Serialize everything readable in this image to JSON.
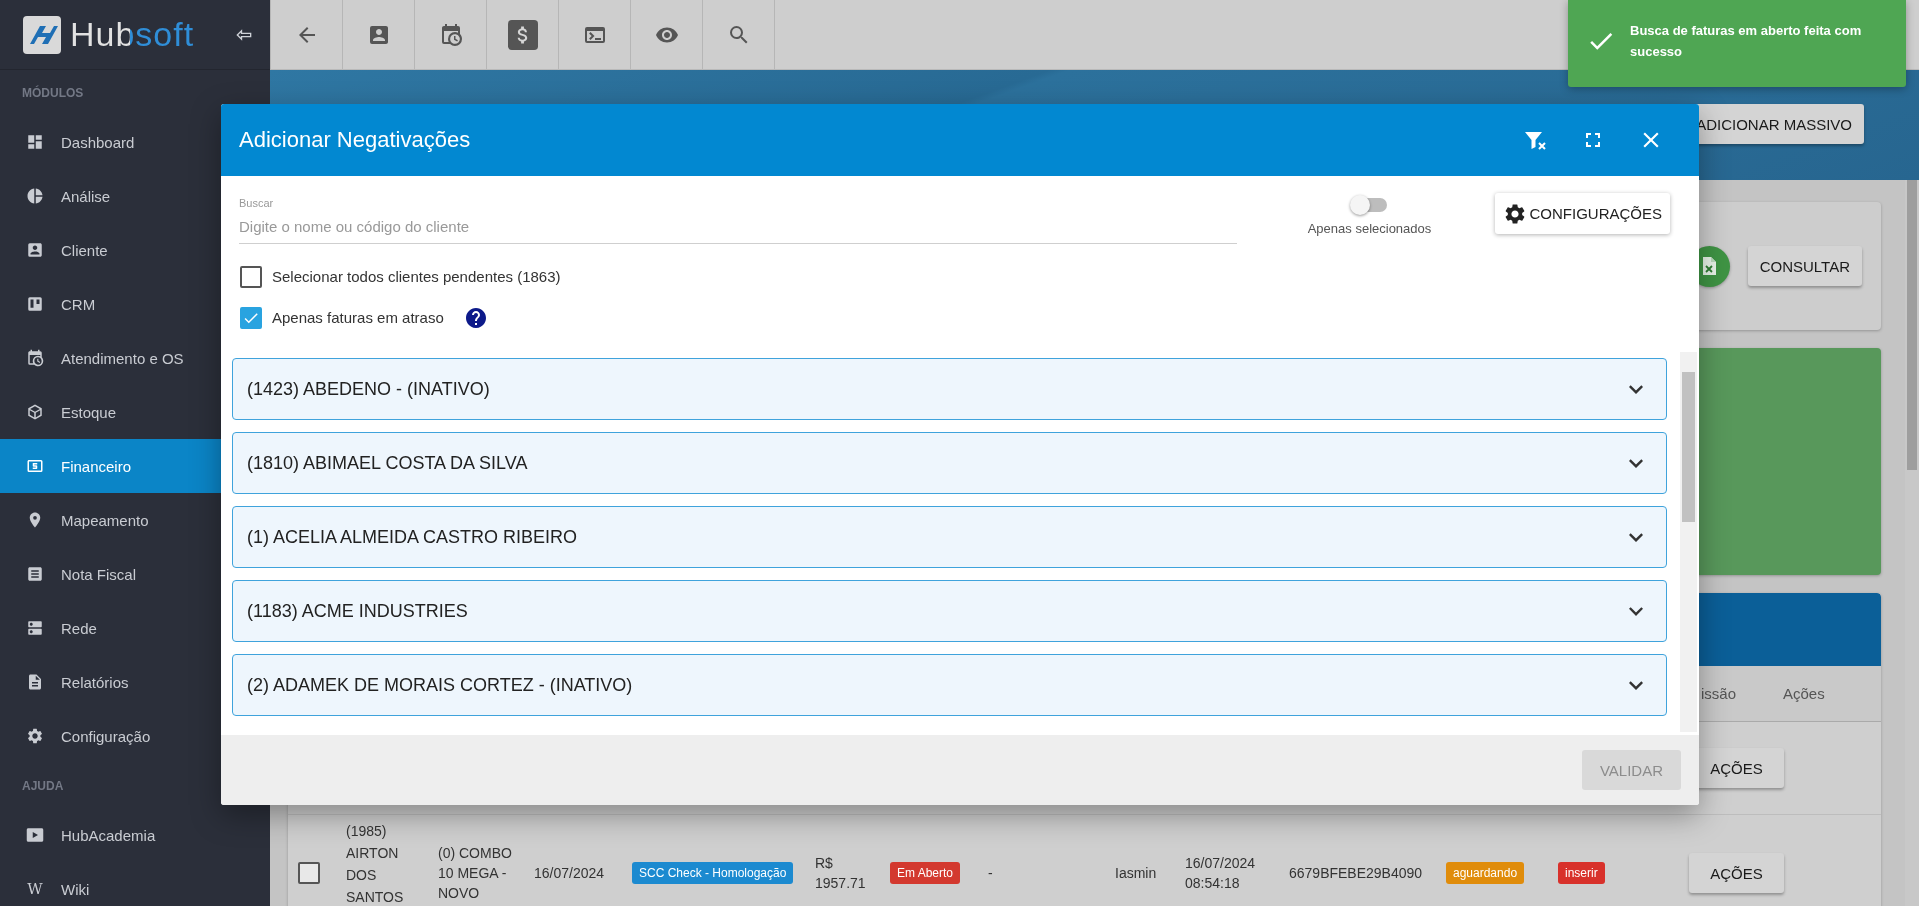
{
  "sidebar": {
    "logo": "Hubsoft",
    "sections": [
      {
        "title": "MÓDULOS",
        "items": [
          {
            "label": "Dashboard",
            "selected": false
          },
          {
            "label": "Análise",
            "selected": false
          },
          {
            "label": "Cliente",
            "selected": false
          },
          {
            "label": "CRM",
            "selected": false
          },
          {
            "label": "Atendimento e OS",
            "selected": false
          },
          {
            "label": "Estoque",
            "selected": false
          },
          {
            "label": "Financeiro",
            "selected": true
          },
          {
            "label": "Mapeamento",
            "selected": false
          },
          {
            "label": "Nota Fiscal",
            "selected": false
          },
          {
            "label": "Rede",
            "selected": false
          },
          {
            "label": "Relatórios",
            "selected": false
          },
          {
            "label": "Configuração",
            "selected": false
          }
        ]
      },
      {
        "title": "AJUDA",
        "items": [
          {
            "label": "HubAcademia",
            "selected": false
          },
          {
            "label": "Wiki",
            "selected": false,
            "icon_char": "W"
          }
        ]
      }
    ]
  },
  "toolbar": {
    "buttons": [
      {
        "selected": false
      },
      {
        "selected": false
      },
      {
        "selected": false
      },
      {
        "selected": true
      },
      {
        "selected": false
      },
      {
        "selected": false
      },
      {
        "selected": false
      }
    ]
  },
  "header": {
    "button": "ADICIONAR MASSIVO"
  },
  "filter_card": {
    "button": "CONSULTAR"
  },
  "table": {
    "columns": [
      "issão",
      "Ações"
    ],
    "rows": [
      {
        "cells": [
          {
            "kind": "button",
            "text": "AÇÕES"
          }
        ]
      },
      {
        "cells": [
          {
            "kind": "checkbox",
            "checked": false
          },
          {
            "kind": "text",
            "text": "(1985) AIRTON DOS SANTOS"
          },
          {
            "kind": "text",
            "text": "(0) COMBO 10 MEGA - NOVO"
          },
          {
            "kind": "text",
            "text": "16/07/2024"
          },
          {
            "kind": "badge",
            "text": "SCC Check - Homologação",
            "color": "#1c8ad0"
          },
          {
            "kind": "text",
            "text": "R$ 1957.71"
          },
          {
            "kind": "badge",
            "text": "Em Aberto",
            "color": "#d3392f"
          },
          {
            "kind": "text",
            "text": "-"
          },
          {
            "kind": "text",
            "text": "Iasmin"
          },
          {
            "kind": "text",
            "text": "16/07/2024 08:54:18"
          },
          {
            "kind": "text",
            "text": "6679BFEBE29B4090"
          },
          {
            "kind": "badge",
            "text": "aguardando",
            "color": "#e08c0b"
          },
          {
            "kind": "badge",
            "text": "inserir",
            "color": "#d8312b"
          },
          {
            "kind": "button",
            "text": "AÇÕES"
          }
        ]
      }
    ]
  },
  "modal": {
    "title": "Adicionar Negativações",
    "search": {
      "label": "Buscar",
      "placeholder": "Digite o nome ou código do cliente"
    },
    "toggle": {
      "label": "Apenas selecionados",
      "on": false
    },
    "settings_button": "CONFIGURAÇÕES",
    "options": [
      {
        "label": "Selecionar todos clientes pendentes (1863)",
        "checked": false,
        "help": false
      },
      {
        "label": "Apenas faturas em atraso",
        "checked": true,
        "help": true
      }
    ],
    "clients": [
      {
        "label": "(1423) ABEDENO - (INATIVO)",
        "expanded": false
      },
      {
        "label": "(1810) ABIMAEL COSTA DA SILVA",
        "expanded": false
      },
      {
        "label": "(1) ACELIA ALMEIDA CASTRO RIBEIRO",
        "expanded": false
      },
      {
        "label": "(1183) ACME INDUSTRIES",
        "expanded": false
      },
      {
        "label": "(2) ADAMEK DE MORAIS CORTEZ - (INATIVO)",
        "expanded": false
      }
    ],
    "validate_button": {
      "label": "VALIDAR",
      "disabled": true
    }
  },
  "toast": {
    "message": "Busca de faturas em aberto feita com sucesso"
  }
}
